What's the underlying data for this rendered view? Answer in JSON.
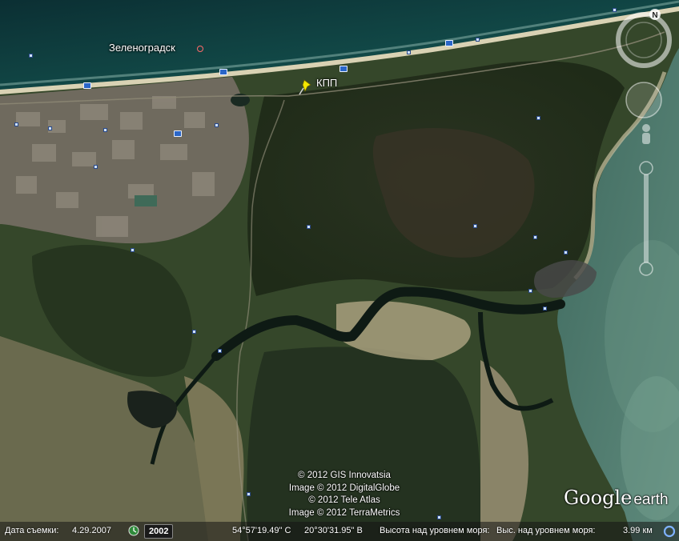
{
  "map": {
    "place_label": "Зеленоградск",
    "pushpin_label": "КПП",
    "credits": [
      "© 2012 GIS Innovatsia",
      "Image © 2012 DigitalGlobe",
      "© 2012 Tele Atlas",
      "Image © 2012 TerraMetrics"
    ],
    "logo_google": "Google",
    "logo_earth": "earth"
  },
  "status": {
    "imagery_date_label": "Дата съемки:",
    "imagery_date": "4.29.2007",
    "year_button": "2002",
    "latitude": "54°57'19.49\" С",
    "longitude": "20°30'31.95\" В",
    "elevation_text": "Высота над уровнем моря:",
    "eye_alt_text": "Выс. над уровнем моря:",
    "eye_alt_value": "3.99 км"
  },
  "icons": {
    "compass": "compass-icon",
    "look": "look-joystick-icon",
    "pegman": "street-view-pegman-icon",
    "zoom": "zoom-slider-icon",
    "timeline": "historical-imagery-icon",
    "spinner": "streaming-status-icon",
    "pushpin": "yellow-pushpin-icon",
    "photo": "panoramio-photo-icon"
  },
  "colors": {
    "sea": "#0f3a36",
    "land": "#2e3f1f",
    "pushpin": "#f3e600",
    "city_dot": "#ff6a6a"
  }
}
